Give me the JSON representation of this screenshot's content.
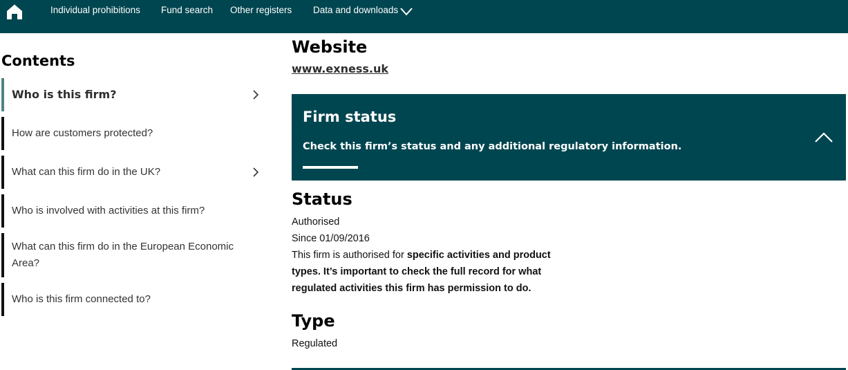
{
  "nav": {
    "items": [
      "Individual prohibitions",
      "Fund search",
      "Other registers",
      "Data and downloads"
    ],
    "home_icon": "home-icon",
    "dropdown_icon": "chevron-down-icon"
  },
  "sidebar": {
    "title": "Contents",
    "items": [
      {
        "label": "Who is this firm?",
        "active": true,
        "has_chevron": true
      },
      {
        "label": "How are customers protected?",
        "active": false,
        "has_chevron": false
      },
      {
        "label": "What can this firm do in the UK?",
        "active": false,
        "has_chevron": true
      },
      {
        "label": "Who is involved with activities at this firm?",
        "active": false,
        "has_chevron": false
      },
      {
        "label_line1": "What can this firm do in the European Economic",
        "label_line2": "Area?",
        "active": false,
        "has_chevron": false
      },
      {
        "label": "Who is this firm connected to?",
        "active": false,
        "has_chevron": false
      }
    ]
  },
  "main": {
    "website_heading": "Website",
    "website_link": "www.exness.uk",
    "firm_status": {
      "title": "Firm status",
      "description": "Check this firm’s status and any additional regulatory information."
    },
    "status_heading": "Status",
    "status_value": "Authorised",
    "status_since": "Since 01/09/2016",
    "status_desc_plain": "This firm is authorised for ",
    "status_desc_bold_1": "specific activities and product",
    "status_desc_bold_2": "types. It’s important to check the full record for what",
    "status_desc_bold_3": "regulated activities this firm has permission to do.",
    "type_heading": "Type",
    "type_value": "Regulated"
  },
  "colors": {
    "brand": "#004650",
    "active_accent": "#4f8584"
  }
}
